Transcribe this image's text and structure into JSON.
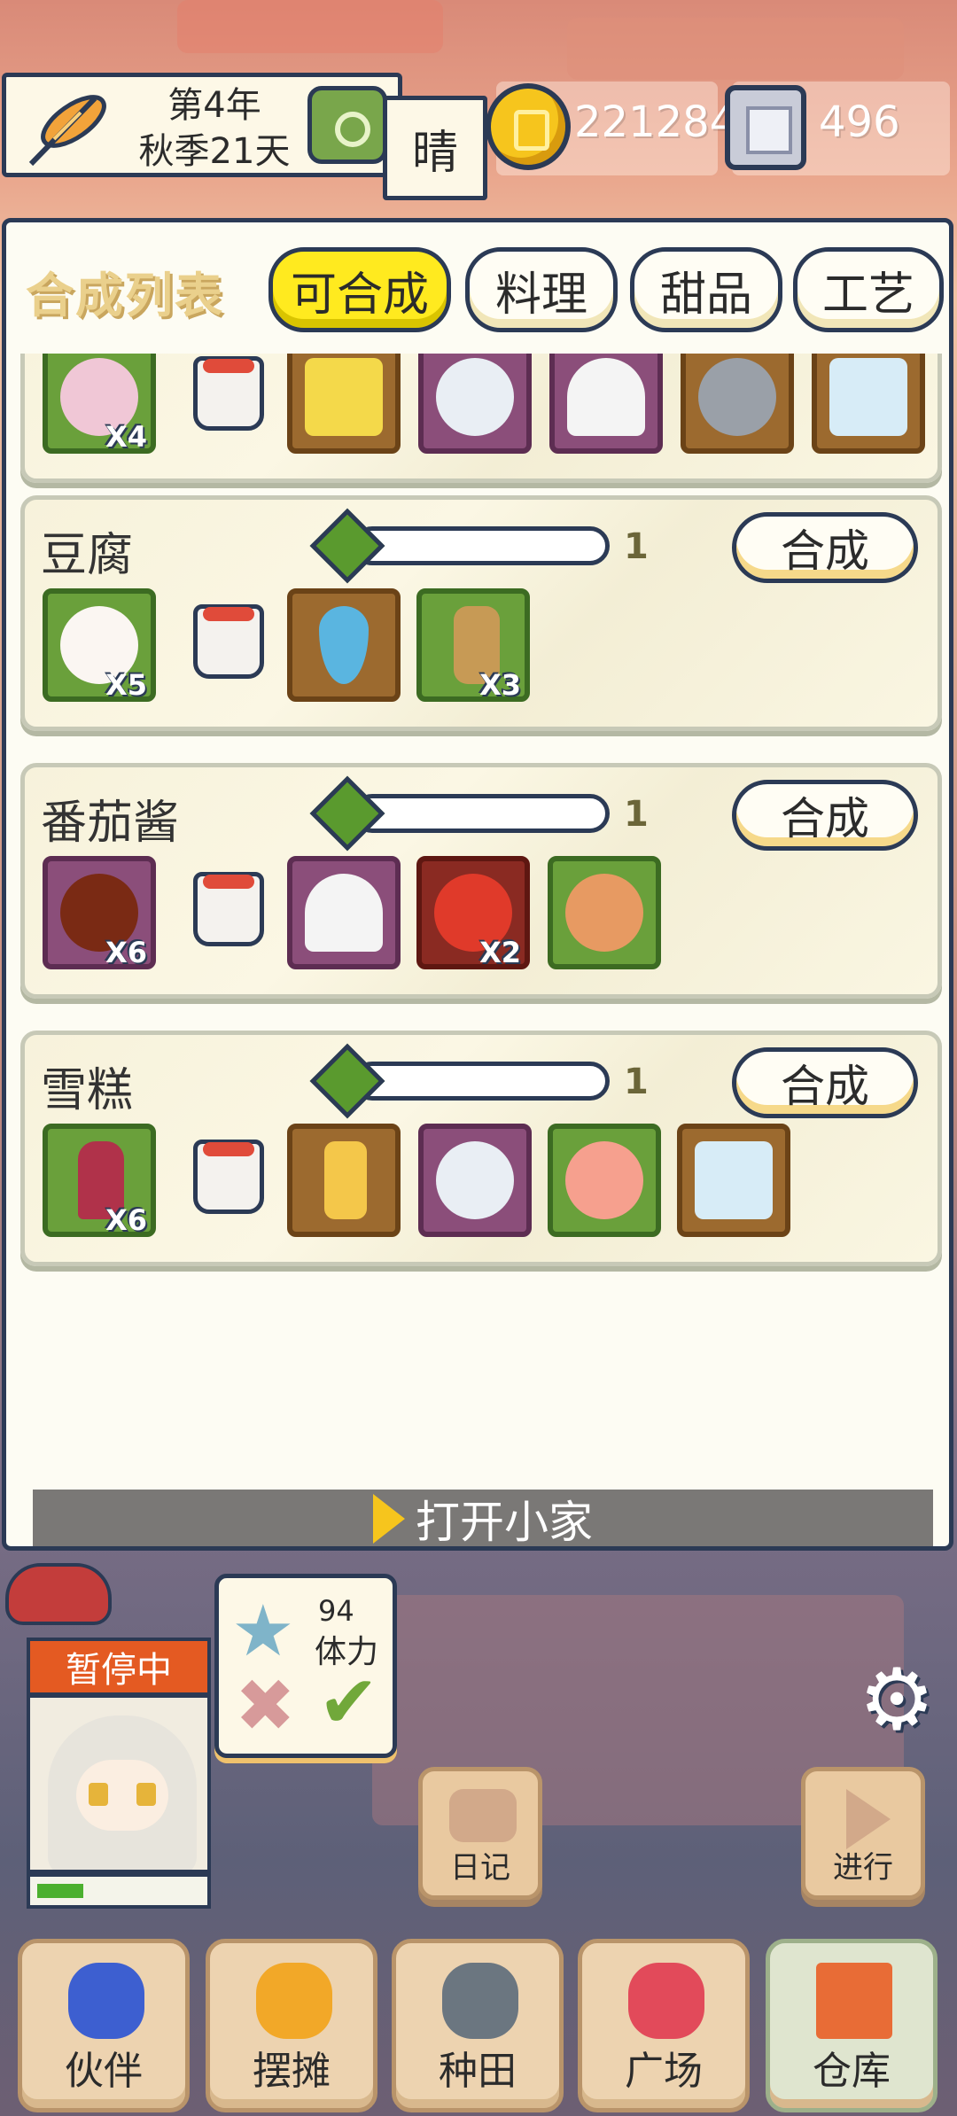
{
  "hud": {
    "date_line1": "第4年",
    "date_line2": "秋季21天",
    "weather": "晴",
    "gold": "221284",
    "gems": "496"
  },
  "panel": {
    "title": "合成列表",
    "tabs": [
      {
        "label": "可合成",
        "active": true
      },
      {
        "label": "料理",
        "active": false
      },
      {
        "label": "甜品",
        "active": false
      },
      {
        "label": "工艺",
        "active": false
      }
    ],
    "partial_row_count": "X4",
    "recipes": [
      {
        "name": "豆腐",
        "quantity": "1",
        "craft_label": "合成",
        "ingredients": [
          {
            "icon": "soybean-icon",
            "color": "green",
            "count": "X5"
          },
          {
            "icon": "cup-icon",
            "color": "none",
            "count": ""
          },
          {
            "icon": "water-drop-icon",
            "color": "orange",
            "count": ""
          },
          {
            "icon": "ginger-icon",
            "color": "green",
            "count": "X3"
          }
        ]
      },
      {
        "name": "番茄酱",
        "quantity": "1",
        "craft_label": "合成",
        "ingredients": [
          {
            "icon": "seasoning-bag-icon",
            "color": "purple",
            "count": "X6"
          },
          {
            "icon": "cup-icon",
            "color": "none",
            "count": ""
          },
          {
            "icon": "salt-icon",
            "color": "purple",
            "count": ""
          },
          {
            "icon": "tomato-icon",
            "color": "red",
            "count": "X2"
          },
          {
            "icon": "onion-icon",
            "color": "green",
            "count": ""
          }
        ]
      },
      {
        "name": "雪糕",
        "quantity": "1",
        "craft_label": "合成",
        "ingredients": [
          {
            "icon": "popsicle-icon",
            "color": "green",
            "count": "X6"
          },
          {
            "icon": "cup-icon",
            "color": "none",
            "count": ""
          },
          {
            "icon": "oil-bottle-icon",
            "color": "orange",
            "count": ""
          },
          {
            "icon": "milk-jar-icon",
            "color": "purple",
            "count": ""
          },
          {
            "icon": "peach-icon",
            "color": "green",
            "count": ""
          },
          {
            "icon": "milk-bottle-icon",
            "color": "orange",
            "count": ""
          }
        ]
      }
    ],
    "open_home": "打开小家"
  },
  "status": {
    "pause": "暂停中",
    "stamina_value": "94",
    "stamina_label": "体力",
    "hp_fraction": 0.28
  },
  "actions": {
    "diary": "日记",
    "proceed": "进行"
  },
  "nav": [
    {
      "label": "伙伴",
      "icon": "partner-icon",
      "active": false
    },
    {
      "label": "摆摊",
      "icon": "stall-icon",
      "active": false
    },
    {
      "label": "种田",
      "icon": "watering-can-icon",
      "active": false
    },
    {
      "label": "广场",
      "icon": "flower-icon",
      "active": false
    },
    {
      "label": "仓库",
      "icon": "house-icon",
      "active": true
    }
  ],
  "colors": {
    "outline": "#2b3a55",
    "active_tab": "#ffea1f",
    "slot_green": "#6aa03b",
    "slot_orange": "#9c6a2f",
    "slot_purple": "#8b4e7a",
    "slot_red": "#8a2a22",
    "pause_badge": "#e45a22"
  }
}
